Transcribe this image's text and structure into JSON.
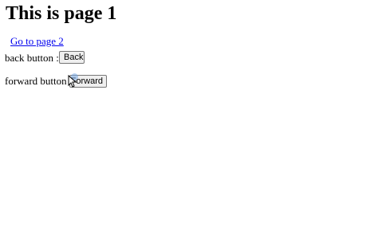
{
  "page": {
    "title": "This is page 1",
    "link_label": "Go to page 2"
  },
  "back_row": {
    "label": "back button :",
    "button_label": "Back"
  },
  "forward_row": {
    "label": "forward button :",
    "button_label": "Forward"
  },
  "icons": {
    "cursor": "mouse-pointer-icon"
  }
}
